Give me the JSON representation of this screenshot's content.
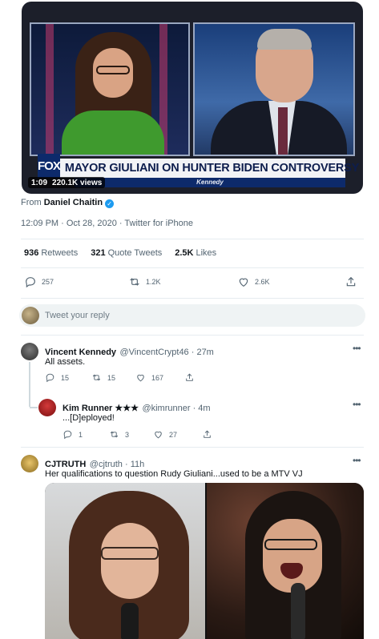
{
  "video": {
    "logo": "FOX",
    "headline": "MAYOR GIULIANI ON HUNTER BIDEN CONTROVERSY",
    "sub_banner": "Kennedy",
    "time": "1:09",
    "views": "220.1K views"
  },
  "tweet": {
    "from_label": "From",
    "from_name": "Daniel Chaitin",
    "timestamp": "12:09 PM · Oct 28, 2020 · Twitter for iPhone",
    "retweets_count": "936",
    "retweets_label": "Retweets",
    "quote_count": "321",
    "quote_label": "Quote Tweets",
    "likes_count": "2.5K",
    "likes_label": "Likes",
    "actions": {
      "reply": "257",
      "retweet": "1.2K",
      "like": "2.6K"
    }
  },
  "reply_box": {
    "placeholder": "Tweet your reply"
  },
  "replies": [
    {
      "name": "Vincent Kennedy",
      "handle": "@VincentCrypt46 · 27m",
      "text": "All assets.",
      "reply": "15",
      "retweet": "15",
      "like": "167"
    },
    {
      "name": "Kim Runner ★★★",
      "handle": "@kimrunner · 4m",
      "text": "...[D]eployed!",
      "reply": "1",
      "retweet": "3",
      "like": "27"
    },
    {
      "name": "CJTRUTH",
      "handle": "@cjtruth · 11h",
      "text": "Her qualifications to question Rudy Giuliani...used to be a MTV VJ"
    }
  ],
  "colors": {
    "accent": "#1d9bf0",
    "muted": "#536471",
    "divider": "#e6ecf0"
  }
}
